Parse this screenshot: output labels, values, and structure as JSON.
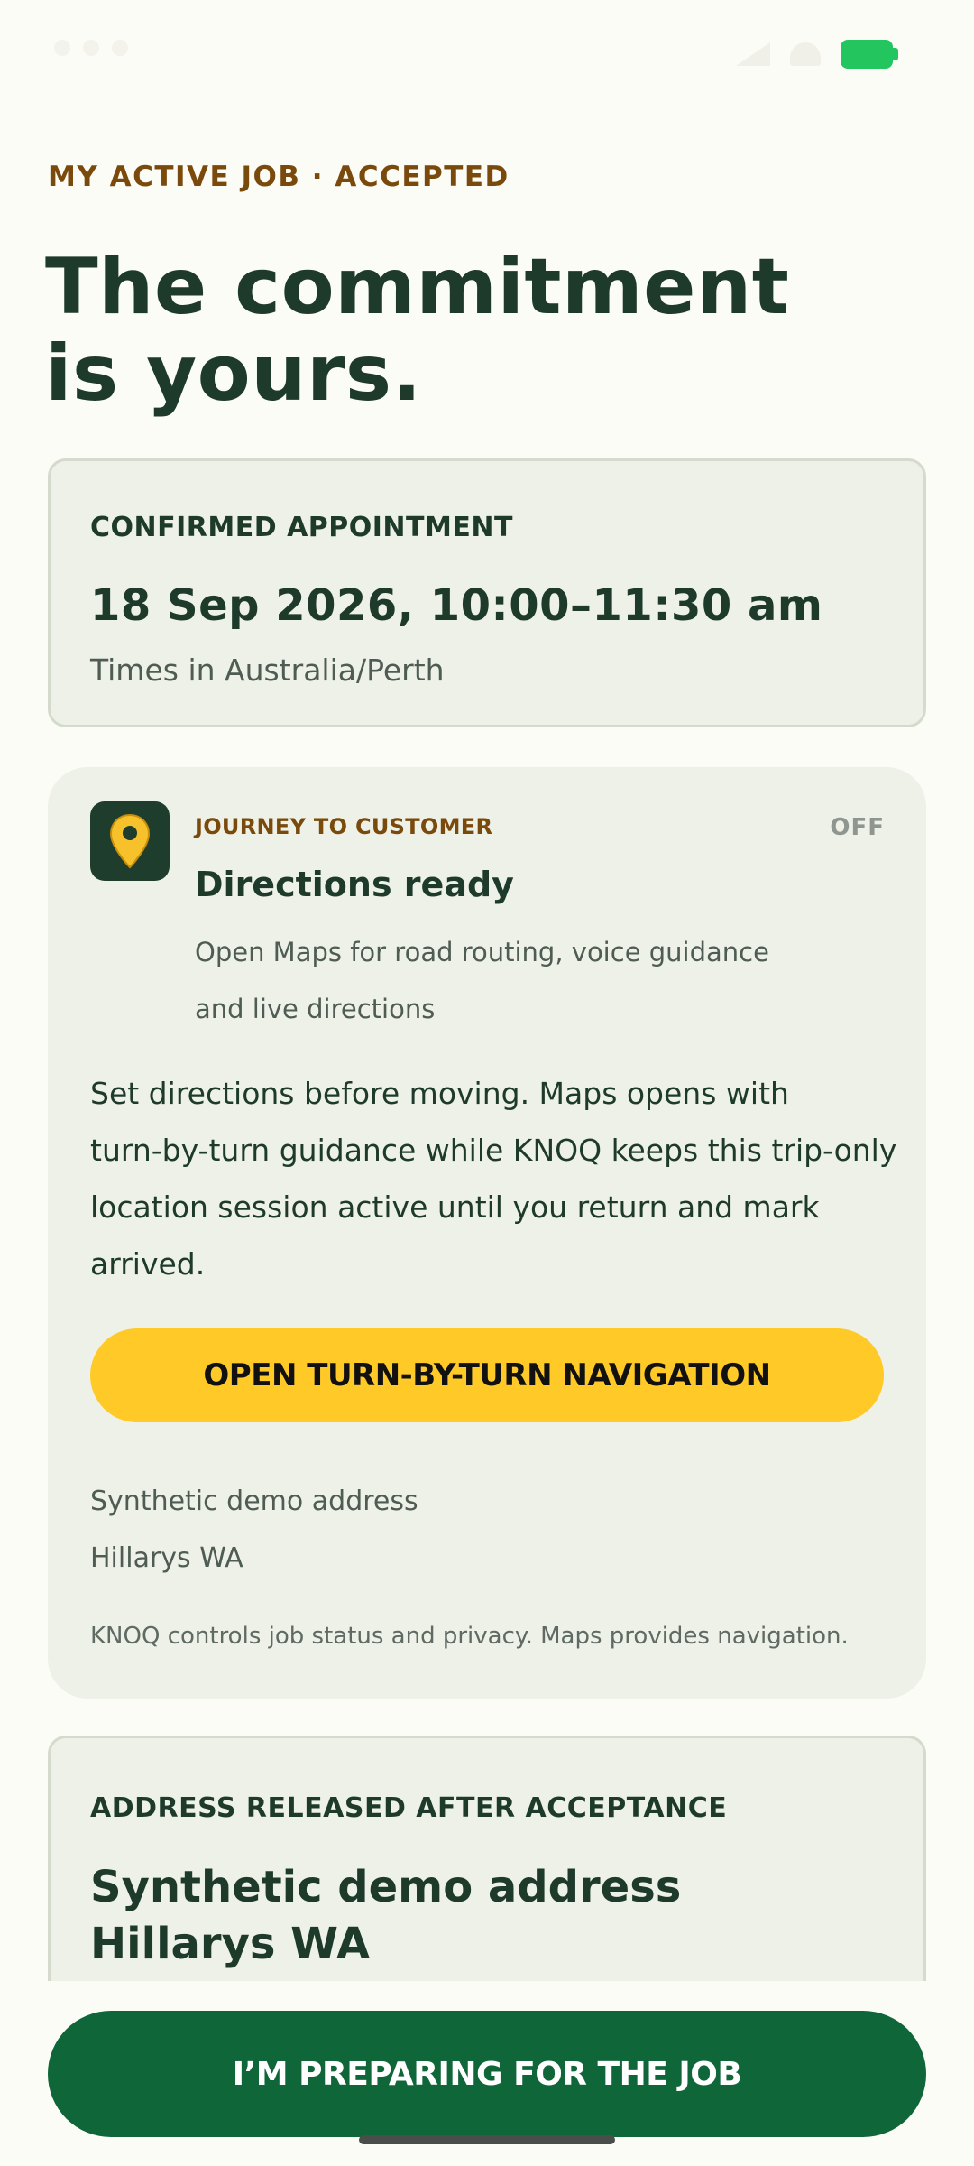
{
  "header": {
    "eyebrow": "MY ACTIVE JOB · ACCEPTED",
    "headline_line1": "The commitment",
    "headline_line2": "is yours."
  },
  "appointment": {
    "label": "CONFIRMED APPOINTMENT",
    "datetime": "18 Sep 2026, 10:00–11:30 am",
    "timezone": "Times in Australia/Perth"
  },
  "journey": {
    "icon": "map-pin-icon",
    "eyebrow": "JOURNEY TO CUSTOMER",
    "status": "OFF",
    "title": "Directions ready",
    "subtitle_line1": "Open Maps for road routing, voice guidance",
    "subtitle_line2": "and live directions",
    "body_line1": "Set directions before moving. Maps opens with",
    "body_line2": "turn-by-turn guidance while KNOQ keeps this trip-only",
    "body_line3": "location session active until you return and mark",
    "body_line4": "arrived.",
    "nav_button_label": "OPEN TURN-BY-TURN NAVIGATION",
    "address_line1": "Synthetic demo address",
    "address_line2": "Hillarys WA",
    "footnote": "KNOQ controls job status and privacy. Maps provides navigation."
  },
  "address_card": {
    "label": "ADDRESS RELEASED AFTER ACCEPTANCE",
    "address_line1": "Synthetic demo address",
    "address_line2": "Hillarys WA"
  },
  "footer": {
    "button_label": "I’M PREPARING FOR THE JOB"
  },
  "colors": {
    "background": "#FCFCF7",
    "card": "#EEF1E8",
    "primary_green": "#0F6638",
    "accent_yellow": "#FFCA28",
    "eyebrow_brown": "#7A4A0C",
    "battery_green": "#22C55E"
  }
}
